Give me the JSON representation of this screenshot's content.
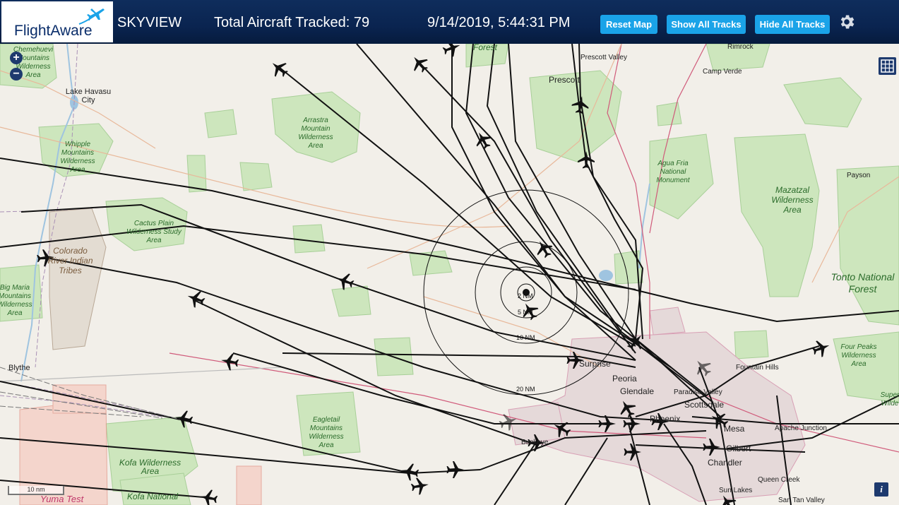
{
  "header": {
    "logo_text": "FlightAware",
    "title": "SKYVIEW",
    "tracked_label": "Total Aircraft Tracked: 79",
    "datetime": "9/14/2019, 5:44:31 PM",
    "buttons": {
      "reset_map": "Reset Map",
      "show_all_tracks": "Show All Tracks",
      "hide_all_tracks": "Hide All Tracks"
    },
    "settings_icon": "gear-icon"
  },
  "map_controls": {
    "zoom_in": "+",
    "zoom_out": "−",
    "layers_icon": "layers-grid-icon",
    "info": "i",
    "scale_label": "10 nm"
  },
  "range_rings": [
    "2 NM",
    "5 NM",
    "10 NM",
    "20 NM"
  ],
  "labels": {
    "chemehuevi": "Chemehuevi Mountains Wilderness Area",
    "lake_havasu": "Lake Havasu City",
    "whipple": "Whipple Mountains Wilderness Area",
    "arrastra": "Arrastra Mountain Wilderness Area",
    "cactus_plain": "Cactus Plain Wilderness Study Area",
    "colorado_tribes": "Colorado River Indian Tribes",
    "big_maria": "Big Maria Mountains Wilderness Area",
    "blythe": "Blythe",
    "eagletail": "Eagletail Mountains Wilderness Area",
    "kofa_wilderness": "Kofa Wilderness Area",
    "kofa_national": "Kofa National",
    "yuma_test": "Yuma Test",
    "forest_top": "Forest",
    "prescott_valley": "Prescott Valley",
    "prescott": "Prescott",
    "rimrock": "Rimrock",
    "camp_verde": "Camp Verde",
    "agua_fria": "Agua Fria National Monument",
    "mazatzal": "Mazatzal Wilderness Area",
    "payson": "Payson",
    "tonto": "Tonto National Forest",
    "four_peaks": "Four Peaks Wilderness Area",
    "superstition": "Super Wilde",
    "surprise": "Surprise",
    "peoria": "Peoria",
    "glendale": "Glendale",
    "paradise_valley": "Paradise Valley",
    "fountain_hills": "Fountain Hills",
    "scottsdale": "Scottsdale",
    "phoenix": "Phoenix",
    "mesa": "Mesa",
    "apache_junction": "Apache Junction",
    "gilbert": "Gilbert",
    "chandler": "Chandler",
    "queen_creek": "Queen Creek",
    "sun_lakes": "Sun Lakes",
    "san_tan_valley": "San Tan Valley",
    "buckeye": "Buckeye"
  },
  "colors": {
    "header_bg": "#0a2450",
    "button_bg": "#1aa3e8",
    "map_bg": "#f2efe9",
    "park_green": "#cde6bd",
    "track_line": "#111111"
  }
}
